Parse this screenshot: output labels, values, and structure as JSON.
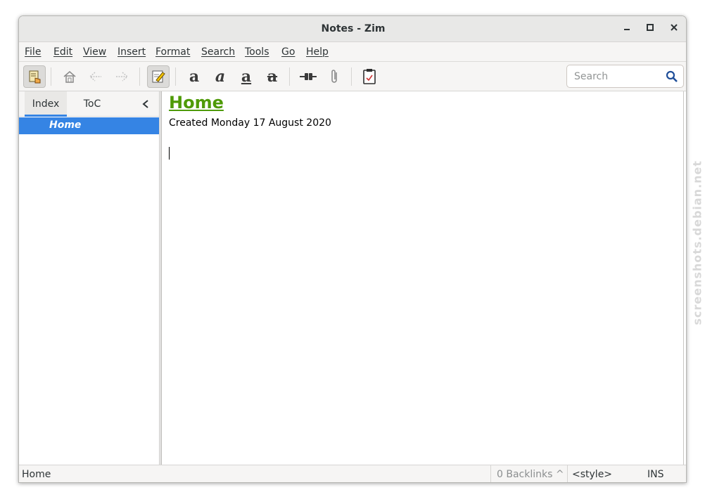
{
  "window": {
    "title": "Notes - Zim"
  },
  "window_controls": {
    "minimize": "–",
    "maximize": "□",
    "close": "×"
  },
  "menubar": {
    "items": [
      {
        "label": "File"
      },
      {
        "label": "Edit"
      },
      {
        "label": "View"
      },
      {
        "label": "Insert"
      },
      {
        "label": "Format"
      },
      {
        "label": "Search"
      },
      {
        "label": "Tools"
      },
      {
        "label": "Go"
      },
      {
        "label": "Help"
      }
    ]
  },
  "toolbar": {
    "format_icons": {
      "bold": "a",
      "italic": "a",
      "underline": "a",
      "strike": "a"
    },
    "search_placeholder": "Search"
  },
  "sidebar": {
    "tabs": [
      {
        "label": "Index"
      },
      {
        "label": "ToC"
      }
    ],
    "collapse_glyph": "‹",
    "tree": [
      {
        "label": "Home",
        "selected": true
      }
    ]
  },
  "editor": {
    "heading": "Home",
    "created": "Created Monday 17 August 2020"
  },
  "statusbar": {
    "page": "Home",
    "backlinks": "0 Backlinks ^",
    "style": "<style>",
    "mode": "INS"
  },
  "watermark": "screenshots.debian.net",
  "colors": {
    "accent": "#3584e4",
    "heading": "#4e9a06"
  }
}
